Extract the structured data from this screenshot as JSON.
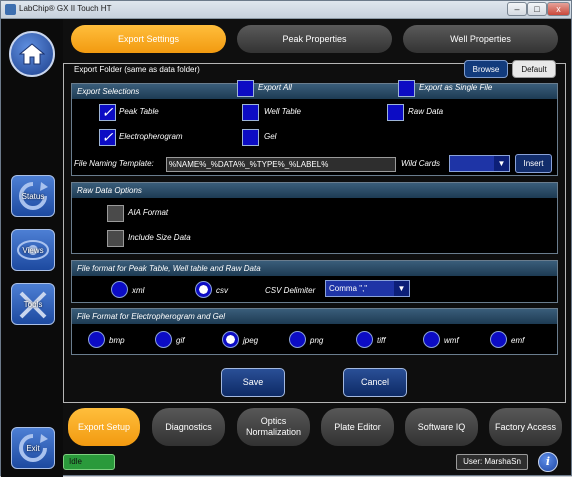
{
  "window": {
    "title": "LabChip® GX II Touch HT",
    "minimize": "–",
    "maximize": "□",
    "close": "x"
  },
  "sidebar": {
    "status": "Status",
    "views": "Views",
    "tools": "Tools",
    "exit": "Exit"
  },
  "tabs": [
    {
      "label": "Export Settings",
      "active": true
    },
    {
      "label": "Peak Properties",
      "active": false
    },
    {
      "label": "Well Properties",
      "active": false
    }
  ],
  "export_folder": {
    "label": "Export Folder  (same as data folder)",
    "browse": "Browse",
    "default": "Default"
  },
  "export_selections": {
    "header": "Export Selections",
    "export_all": {
      "label": "Export All",
      "checked": false
    },
    "export_single": {
      "label": "Export as Single File",
      "checked": false
    },
    "peak_table": {
      "label": "Peak Table",
      "checked": true
    },
    "well_table": {
      "label": "Well Table",
      "checked": false
    },
    "raw_data": {
      "label": "Raw Data",
      "checked": false
    },
    "electropherogram": {
      "label": "Electropherogram",
      "checked": true
    },
    "gel": {
      "label": "Gel",
      "checked": false
    },
    "check_mark": "✓",
    "naming_label": "File Naming Template:",
    "naming_value": "%NAME%_%DATA%_%TYPE%_%LABEL%",
    "wildcards_label": "Wild Cards",
    "wildcards_value": "",
    "insert": "Insert"
  },
  "raw_data_options": {
    "header": "Raw Data Options",
    "aia_format": "AIA Format",
    "include_size": "Include Size Data"
  },
  "file_format_tables": {
    "header": "File format for Peak Table, Well table and Raw Data",
    "xml": "xml",
    "csv": "csv",
    "selected": "csv",
    "csv_delimiter_label": "CSV Delimiter",
    "csv_delimiter_value": "Comma \",\""
  },
  "file_format_images": {
    "header": "File Format for Electropherogram and Gel",
    "options": [
      "bmp",
      "gif",
      "jpeg",
      "png",
      "tiff",
      "wmf",
      "emf"
    ],
    "selected": "jpeg"
  },
  "actions": {
    "save": "Save",
    "cancel": "Cancel"
  },
  "bottom_tabs": [
    {
      "label": "Export Setup",
      "active": true
    },
    {
      "label": "Diagnostics",
      "active": false
    },
    {
      "label": "Optics Normalization",
      "active": false
    },
    {
      "label": "Plate Editor",
      "active": false
    },
    {
      "label": "Software IQ",
      "active": false
    },
    {
      "label": "Factory Access",
      "active": false
    }
  ],
  "status": "Idle",
  "user": "User: MarshaSn",
  "info_icon": "i",
  "dropdown_arrow": "▼"
}
